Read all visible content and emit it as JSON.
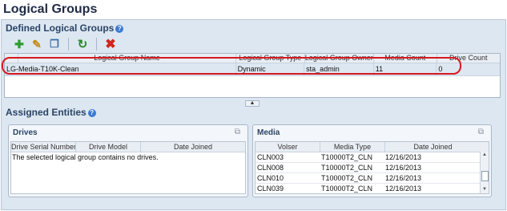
{
  "page": {
    "title": "Logical Groups"
  },
  "defined": {
    "title": "Defined Logical Groups",
    "help": "?",
    "columns": [
      "",
      "Logical Group Name",
      "Logical Group Type",
      "Logical Group Owner",
      "Media Count",
      "Drive Count"
    ],
    "rows": [
      {
        "name": "LG-Media-T10K-Clean",
        "type": "Dynamic",
        "owner": "sta_admin",
        "media_count": "11",
        "drive_count": "0"
      }
    ]
  },
  "toolbar": {
    "icons": [
      "add-icon",
      "edit-icon",
      "copy-icon",
      "refresh-icon",
      "delete-icon"
    ]
  },
  "assigned": {
    "title": "Assigned Entities",
    "help": "?"
  },
  "drives": {
    "title": "Drives",
    "columns": [
      "Drive Serial Number",
      "Drive Model",
      "Date Joined"
    ],
    "empty_message": "The selected logical group contains no drives."
  },
  "media": {
    "title": "Media",
    "columns": [
      "Volser",
      "Media Type",
      "Date Joined"
    ],
    "rows": [
      {
        "volser": "CLN003",
        "media_type": "T10000T2_CLN",
        "date_joined": "12/16/2013"
      },
      {
        "volser": "CLN008",
        "media_type": "T10000T2_CLN",
        "date_joined": "12/16/2013"
      },
      {
        "volser": "CLN010",
        "media_type": "T10000T2_CLN",
        "date_joined": "12/16/2013"
      },
      {
        "volser": "CLN039",
        "media_type": "T10000T2_CLN",
        "date_joined": "12/16/2013"
      }
    ]
  },
  "colors": {
    "highlight": "#d7181f",
    "accent": "#2a4466"
  }
}
